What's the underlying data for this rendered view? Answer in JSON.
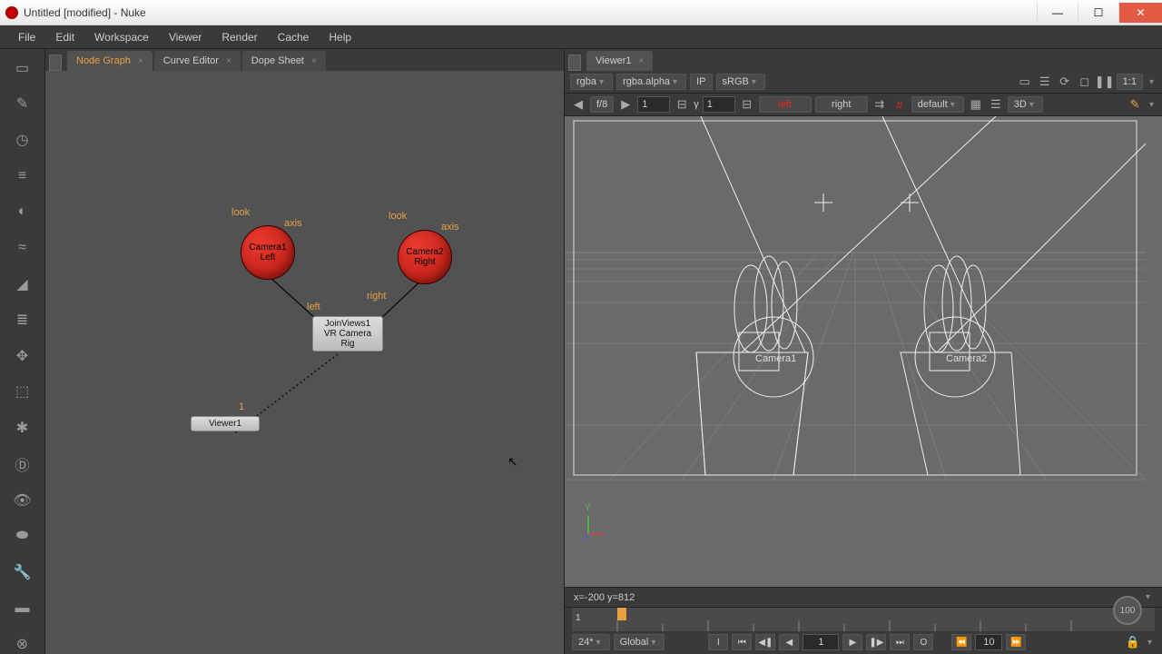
{
  "window": {
    "title": "Untitled [modified] - Nuke"
  },
  "menu": [
    "File",
    "Edit",
    "Workspace",
    "Viewer",
    "Render",
    "Cache",
    "Help"
  ],
  "left_tabs": [
    {
      "label": "Node Graph",
      "active": true
    },
    {
      "label": "Curve Editor",
      "active": false
    },
    {
      "label": "Dope Sheet",
      "active": false
    }
  ],
  "right_tabs": [
    {
      "label": "Viewer1",
      "active": true
    }
  ],
  "node_graph": {
    "nodes": {
      "cam1": {
        "line1": "Camera1",
        "line2": "Left"
      },
      "cam2": {
        "line1": "Camera2",
        "line2": "Right"
      },
      "join": {
        "line1": "JoinViews1",
        "line2": "VR Camera Rig"
      },
      "viewer": {
        "label": "Viewer1"
      }
    },
    "labels": {
      "look1": "look",
      "axis1": "axis",
      "look2": "look",
      "axis2": "axis",
      "left_in": "left",
      "right_in": "right",
      "viewer_in": "1"
    }
  },
  "viewer_bar1": {
    "channel": "rgba",
    "alpha": "rgba.alpha",
    "ip": "IP",
    "colorspace": "sRGB",
    "ratio": "1:1"
  },
  "viewer_bar2": {
    "fstop": "f/8",
    "frame": "1",
    "gamma_label": "γ",
    "gamma": "1",
    "left": "left",
    "right": "right",
    "default": "default",
    "mode3d": "3D"
  },
  "viewport": {
    "cam1_label": "Camera1",
    "cam2_label": "Camera2",
    "axis_y": "Y"
  },
  "status": {
    "coords": "x=-200 y=812"
  },
  "timeline": {
    "start": "1",
    "fps": "24*",
    "mode": "Global",
    "current": "1",
    "step": "10",
    "dial": "100"
  }
}
